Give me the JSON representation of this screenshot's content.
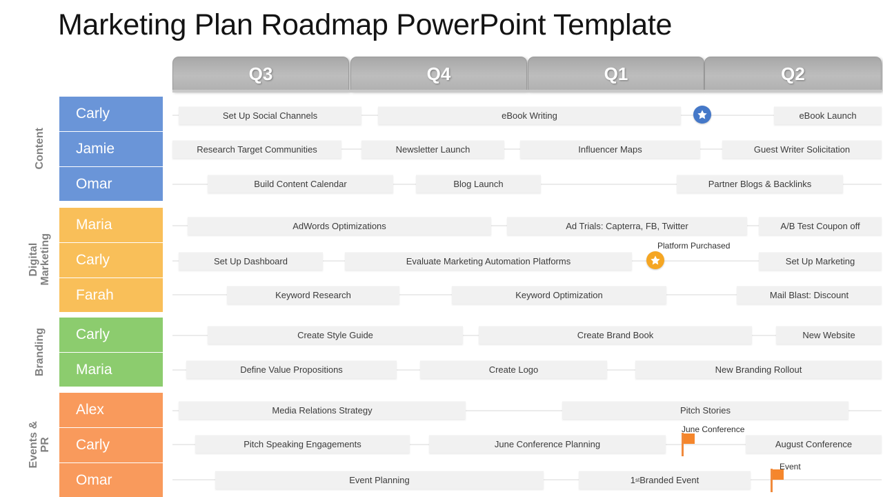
{
  "title": "Marketing Plan Roadmap PowerPoint Template",
  "quarters": [
    {
      "label": "Q3"
    },
    {
      "label": "Q4"
    },
    {
      "label": "Q1"
    },
    {
      "label": "Q2"
    }
  ],
  "groups": [
    {
      "label": "Content"
    },
    {
      "label": "Digital\nMarketing"
    },
    {
      "label": "Branding"
    },
    {
      "label": "Events &\nPR"
    }
  ],
  "rows": [
    {
      "owner": "Carly",
      "tasks": [
        {
          "label": "Set Up Social Channels"
        },
        {
          "label": "eBook Writing"
        },
        {
          "label": "eBook Launch"
        }
      ]
    },
    {
      "owner": "Jamie",
      "tasks": [
        {
          "label": "Research Target Communities"
        },
        {
          "label": "Newsletter Launch"
        },
        {
          "label": "Influencer Maps"
        },
        {
          "label": "Guest Writer Solicitation"
        }
      ]
    },
    {
      "owner": "Omar",
      "tasks": [
        {
          "label": "Build Content Calendar"
        },
        {
          "label": "Blog Launch"
        },
        {
          "label": "Partner Blogs & Backlinks"
        }
      ]
    },
    {
      "owner": "Maria",
      "tasks": [
        {
          "label": "AdWords Optimizations"
        },
        {
          "label": "Ad Trials: Capterra, FB, Twitter"
        },
        {
          "label": "A/B Test Coupon off"
        }
      ]
    },
    {
      "owner": "Carly",
      "tasks": [
        {
          "label": "Set Up Dashboard"
        },
        {
          "label": "Evaluate Marketing Automation Platforms"
        },
        {
          "label": "Set Up Marketing"
        }
      ]
    },
    {
      "owner": "Farah",
      "tasks": [
        {
          "label": "Keyword Research"
        },
        {
          "label": "Keyword Optimization"
        },
        {
          "label": "Mail Blast: Discount"
        }
      ]
    },
    {
      "owner": "Carly",
      "tasks": [
        {
          "label": "Create Style Guide"
        },
        {
          "label": "Create Brand Book"
        },
        {
          "label": "New Website"
        }
      ]
    },
    {
      "owner": "Maria",
      "tasks": [
        {
          "label": "Define Value Propositions"
        },
        {
          "label": "Create Logo"
        },
        {
          "label": "New Branding Rollout"
        }
      ]
    },
    {
      "owner": "Alex",
      "tasks": [
        {
          "label": "Media Relations Strategy"
        },
        {
          "label": "Pitch Stories"
        }
      ]
    },
    {
      "owner": "Carly",
      "tasks": [
        {
          "label": "Pitch Speaking Engagements"
        },
        {
          "label": "June Conference Planning"
        },
        {
          "label": "August Conference"
        }
      ]
    },
    {
      "owner": "Omar",
      "tasks": [
        {
          "label": "Event Planning"
        },
        {
          "label": "1st Branded Event"
        }
      ]
    }
  ],
  "milestones": [
    {
      "kind": "star",
      "color": "blue",
      "label": ""
    },
    {
      "kind": "star",
      "color": "orange",
      "label": "Platform Purchased"
    },
    {
      "kind": "flag",
      "color": "orange",
      "label": "June Conference"
    },
    {
      "kind": "flag",
      "color": "orange",
      "label": "Event"
    }
  ],
  "colors": {
    "content": "#6a95d8",
    "digital_marketing": "#f9bf59",
    "branding": "#8ccc6e",
    "events_pr": "#f99a5c",
    "milestone_blue": "#4578c8",
    "milestone_orange": "#f5a623",
    "flag_orange": "#f5862c",
    "task_bar": "#f1f1f1",
    "header_tab": "#b3b3b3"
  }
}
